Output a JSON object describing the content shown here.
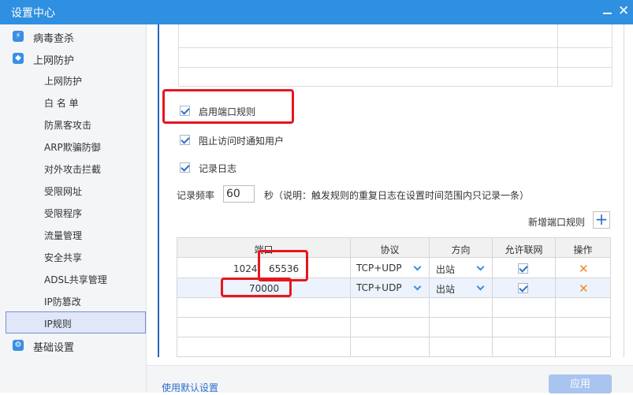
{
  "window": {
    "title": "设置中心",
    "close_symbol": "✕"
  },
  "sidebar": {
    "categories": [
      {
        "label": "病毒查杀",
        "icon": "lightning-icon"
      },
      {
        "label": "上网防护",
        "icon": "shield-icon"
      },
      {
        "label": "基础设置",
        "icon": "gear-icon"
      }
    ],
    "items": [
      {
        "label": "上网防护"
      },
      {
        "label": "白 名 单"
      },
      {
        "label": "防黑客攻击"
      },
      {
        "label": "ARP欺骗防御"
      },
      {
        "label": "对外攻击拦截"
      },
      {
        "label": "受限网址"
      },
      {
        "label": "受限程序"
      },
      {
        "label": "流量管理"
      },
      {
        "label": "安全共享"
      },
      {
        "label": "ADSL共享管理"
      },
      {
        "label": "IP防篡改"
      },
      {
        "label": "IP规则"
      }
    ],
    "active_item": "IP规则"
  },
  "options": {
    "enable_port_rules": {
      "label": "启用端口规则",
      "checked": true
    },
    "notify_user": {
      "label": "阻止访问时通知用户",
      "checked": true
    },
    "log": {
      "label": "记录日志",
      "checked": true
    }
  },
  "frequency": {
    "label": "记录频率",
    "value": "60",
    "note": "秒（说明：触发规则的重复日志在设置时间范围内只记录一条）"
  },
  "add_port_rule": {
    "label": "新增端口规则",
    "symbol": "+"
  },
  "table": {
    "headers": {
      "port": "端口",
      "protocol": "协议",
      "direction": "方向",
      "allow": "允许联网",
      "action": "操作"
    },
    "rows": [
      {
        "port_start": "1024",
        "port_sep": "-",
        "port_end": "65536",
        "protocol": "TCP+UDP",
        "direction": "出站",
        "allow": true,
        "delete_symbol": "✕"
      },
      {
        "port": "70000",
        "protocol": "TCP+UDP",
        "direction": "出站",
        "allow": true,
        "delete_symbol": "✕"
      }
    ]
  },
  "footer": {
    "default_link": "使用默认设置",
    "apply": "应用"
  },
  "colors": {
    "accent": "#2f8fe0",
    "highlight": "#e6161f",
    "delete": "#f08a1c"
  }
}
